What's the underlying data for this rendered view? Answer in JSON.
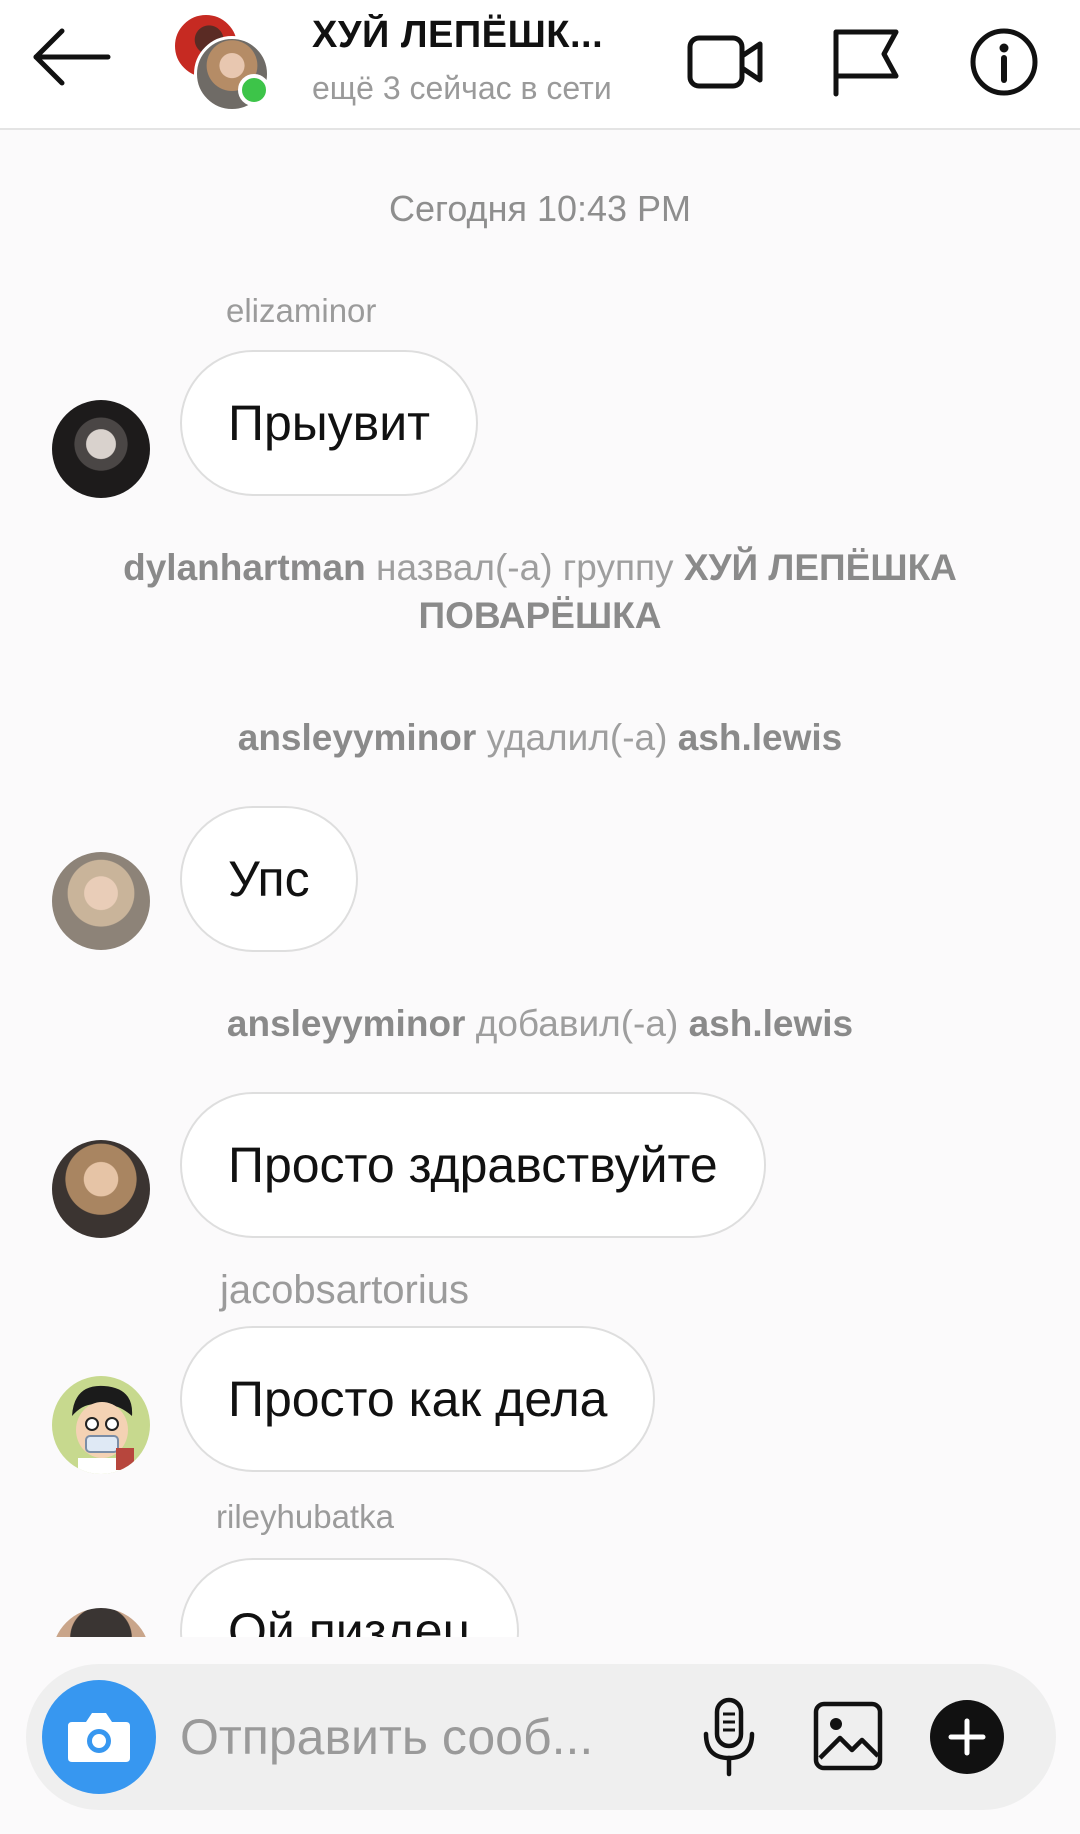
{
  "header": {
    "title": "ХУЙ ЛЕПЁШК...",
    "subtitle": "ещё 3 сейчас в сети",
    "icons": [
      "back-arrow-icon",
      "video-camera-icon",
      "flag-icon",
      "info-icon"
    ]
  },
  "messages": {
    "timestamp": "Сегодня 10:43 PM",
    "m1": {
      "username": "elizaminor",
      "text": "Прыувит"
    },
    "sys1": {
      "user": "dylanhartman",
      "action": "назвал(-а) группу",
      "target": "ХУЙ ЛЕПЁШКА ПОВАРЁШКА"
    },
    "sys2": {
      "user": "ansleyyminor",
      "action": "удалил(-а)",
      "target": "ash.lewis"
    },
    "m2": {
      "text": "Упс"
    },
    "sys3": {
      "user": "ansleyyminor",
      "action": "добавил(-а)",
      "target": "ash.lewis"
    },
    "m3": {
      "text": "Просто здравствуйте"
    },
    "m4": {
      "username": "jacobsartorius",
      "text": "Просто как дела"
    },
    "m5": {
      "username": "rileyhubatka",
      "text": "Ой пиздец"
    }
  },
  "composer": {
    "placeholder": "Отправить сооб...",
    "icons": [
      "camera-icon",
      "microphone-icon",
      "gallery-icon",
      "plus-icon"
    ]
  },
  "colors": {
    "online": "#3dc449",
    "camera_button": "#3797f0",
    "bubble_border": "#dedede",
    "muted_text": "#9a9a9a"
  }
}
